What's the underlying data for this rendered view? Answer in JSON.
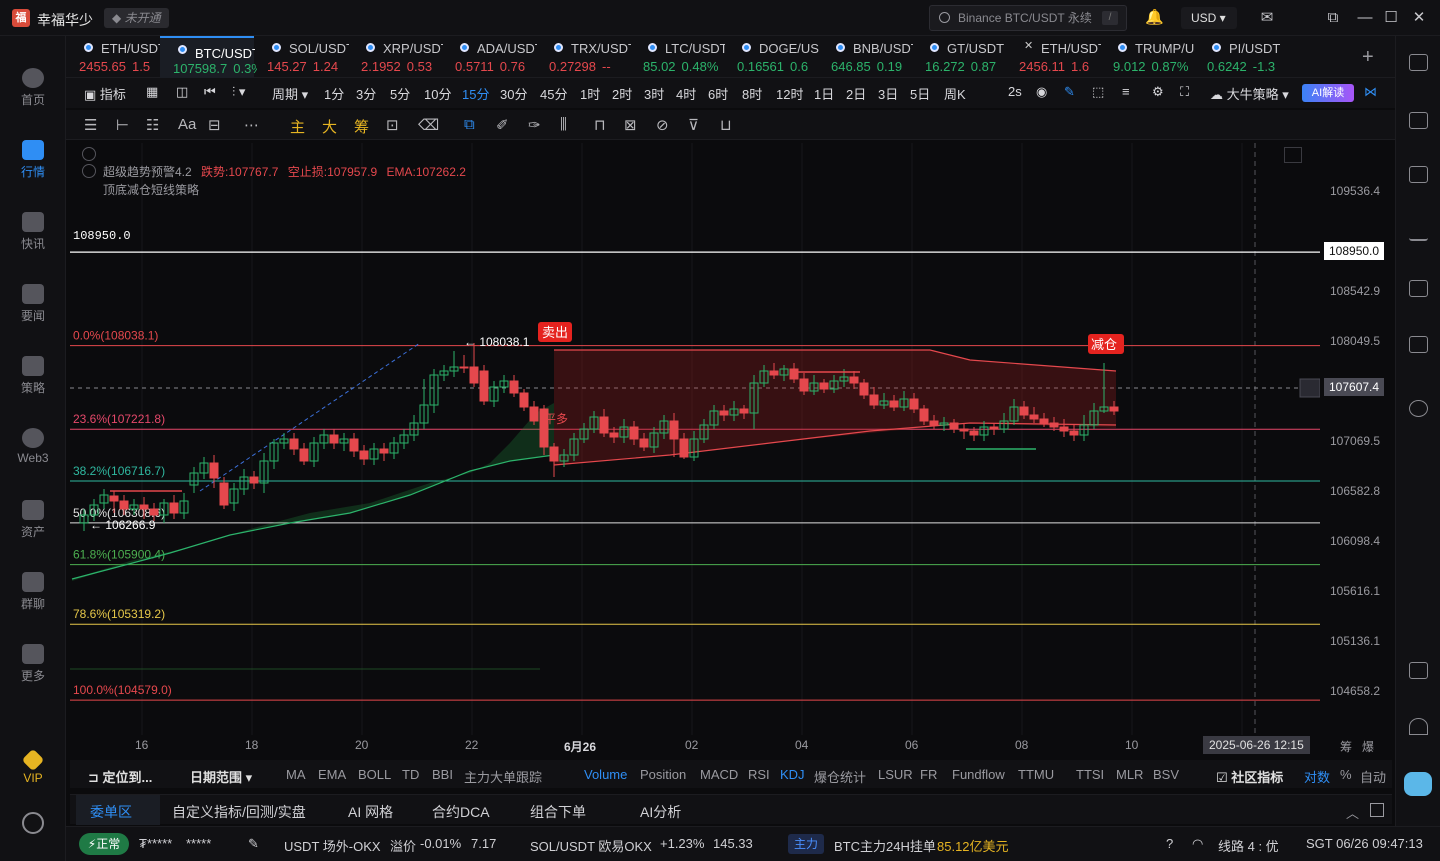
{
  "app": {
    "username": "幸福华少",
    "status": "未开通"
  },
  "search": {
    "placeholder": "Binance BTC/USDT 永续",
    "shortcut": "/"
  },
  "currency": "USD",
  "sidebar": [
    {
      "label": "首页",
      "icon": "home-icon"
    },
    {
      "label": "行情",
      "icon": "market-icon"
    },
    {
      "label": "快讯",
      "icon": "news-flash-icon"
    },
    {
      "label": "要闻",
      "icon": "headline-icon"
    },
    {
      "label": "策略",
      "icon": "strategy-icon"
    },
    {
      "label": "Web3",
      "icon": "web3-icon"
    },
    {
      "label": "资产",
      "icon": "wallet-icon"
    },
    {
      "label": "群聊",
      "icon": "chat-icon"
    },
    {
      "label": "更多",
      "icon": "more-icon"
    },
    {
      "label": "VIP",
      "icon": "vip-icon"
    }
  ],
  "tabs": [
    {
      "name": "ETH/USDT",
      "price": "2455.65",
      "change": "1.5",
      "dir": "red"
    },
    {
      "name": "BTC/USDT永续",
      "price": "107598.7",
      "change": "0.3%",
      "dir": "green"
    },
    {
      "name": "SOL/USDT",
      "price": "145.27",
      "change": "1.24",
      "dir": "red"
    },
    {
      "name": "XRP/USDT",
      "price": "2.1952",
      "change": "0.53",
      "dir": "red"
    },
    {
      "name": "ADA/USDT",
      "price": "0.5711",
      "change": "0.76",
      "dir": "red"
    },
    {
      "name": "TRX/USDT",
      "price": "0.27298",
      "change": "--",
      "dir": "red"
    },
    {
      "name": "LTC/USDT",
      "price": "85.02",
      "change": "0.48%",
      "dir": "green"
    },
    {
      "name": "DOGE/USDT",
      "price": "0.16561",
      "change": "0.6",
      "dir": "green"
    },
    {
      "name": "BNB/USDT",
      "price": "646.85",
      "change": "0.19",
      "dir": "green"
    },
    {
      "name": "GT/USDT",
      "price": "16.272",
      "change": "0.87",
      "dir": "green"
    },
    {
      "name": "ETH/USDT",
      "price": "2456.11",
      "change": "1.6",
      "dir": "red"
    },
    {
      "name": "TRUMP/USDT",
      "price": "9.012",
      "change": "0.87%",
      "dir": "green"
    },
    {
      "name": "PI/USDT",
      "price": "0.6242",
      "change": "-1.3",
      "dir": "green"
    }
  ],
  "toolbar": {
    "indicator": "指标",
    "period": "周期",
    "timeframes": [
      "1分",
      "3分",
      "5分",
      "10分",
      "15分",
      "30分",
      "45分",
      "1时",
      "2时",
      "3时",
      "4时",
      "6时",
      "8时",
      "12时",
      "1日",
      "2日",
      "3日",
      "5日",
      "周K"
    ],
    "active_tf": "15分",
    "refresh": "2s",
    "strategy": "大牛策略",
    "ai": "AI解读"
  },
  "toolbar2": {
    "zhu": "主",
    "da": "大",
    "chou": "筹"
  },
  "chart_data": {
    "type": "candlestick",
    "legend_line1": "超级趋势预警4.2",
    "legend_fall": "跌势:107767.7",
    "legend_stop": "空止损:107957.9",
    "legend_ema": "EMA:107262.2",
    "legend_line2": "顶底减仓短线策略",
    "hline_top": "108950.0",
    "fib": [
      {
        "label": "0.0%(108038.1)",
        "price": 108038.1,
        "color": "#e5484d"
      },
      {
        "label": "23.6%(107221.8)",
        "price": 107221.8,
        "color": "#e5486a"
      },
      {
        "label": "38.2%(106716.7)",
        "price": 106716.7,
        "color": "#2fb8a0"
      },
      {
        "label": "50.0%(106308.6)",
        "price": 106308.6,
        "color": "#e0e0e0"
      },
      {
        "label": "61.8%(105900.4)",
        "price": 105900.4,
        "color": "#4caf50"
      },
      {
        "label": "78.6%(105319.2)",
        "price": 105319.2,
        "color": "#e6c84a"
      },
      {
        "label": "100.0%(104579.0)",
        "price": 104579.0,
        "color": "#e5484d"
      }
    ],
    "high_mark": "108038.1",
    "low_mark": "106266.9",
    "sell_label": "卖出",
    "reduce_label": "减仓",
    "flat_label": "平多",
    "y_ticks": [
      "109536.4",
      "108542.9",
      "108049.5",
      "107069.5",
      "106582.8",
      "106098.4",
      "105616.1",
      "105136.1",
      "104658.2"
    ],
    "current_price": "107607.4",
    "top_price_tag": "108950.0",
    "x_ticks": [
      "16",
      "18",
      "20",
      "22",
      "6月26",
      "02",
      "04",
      "06",
      "08",
      "10"
    ],
    "crosshair_time": "2025-06-26 12:15",
    "x_right": [
      "筹",
      "爆"
    ]
  },
  "indicators": {
    "locate": "定位到...",
    "range": "日期范围",
    "items": [
      "MA",
      "EMA",
      "BOLL",
      "TD",
      "BBI",
      "主力大单跟踪"
    ],
    "sub_items": [
      "Volume",
      "Position",
      "MACD",
      "RSI",
      "KDJ",
      "爆仓统计",
      "LSUR",
      "FR",
      "Fundflow",
      "TTMU",
      "TTSI",
      "MLR",
      "BSV"
    ],
    "active": [
      "Volume",
      "KDJ"
    ],
    "community": "社区指标",
    "scale_log": "对数",
    "scale_pct": "%",
    "scale_auto": "自动"
  },
  "bottom_tabs": [
    "委单区",
    "自定义指标/回测/实盘",
    "AI 网格",
    "合约DCA",
    "组合下单",
    "AI分析"
  ],
  "statusbar": {
    "ok": "正常",
    "masked1": "₮*****",
    "masked2": "*****",
    "usdt_otc": "USDT 场外-OKX",
    "premium_label": "溢价",
    "premium": "-0.01%",
    "premium_val": "7.17",
    "sol_pair": "SOL/USDT 欧易OKX",
    "sol_change": "+1.23%",
    "sol_price": "145.33",
    "main_tag": "主力",
    "btc_text": "BTC主力24H挂单",
    "btc_amount": "85.12亿美元",
    "line": "线路 4 : 优",
    "time": "SGT 06/26 09:47:13"
  }
}
